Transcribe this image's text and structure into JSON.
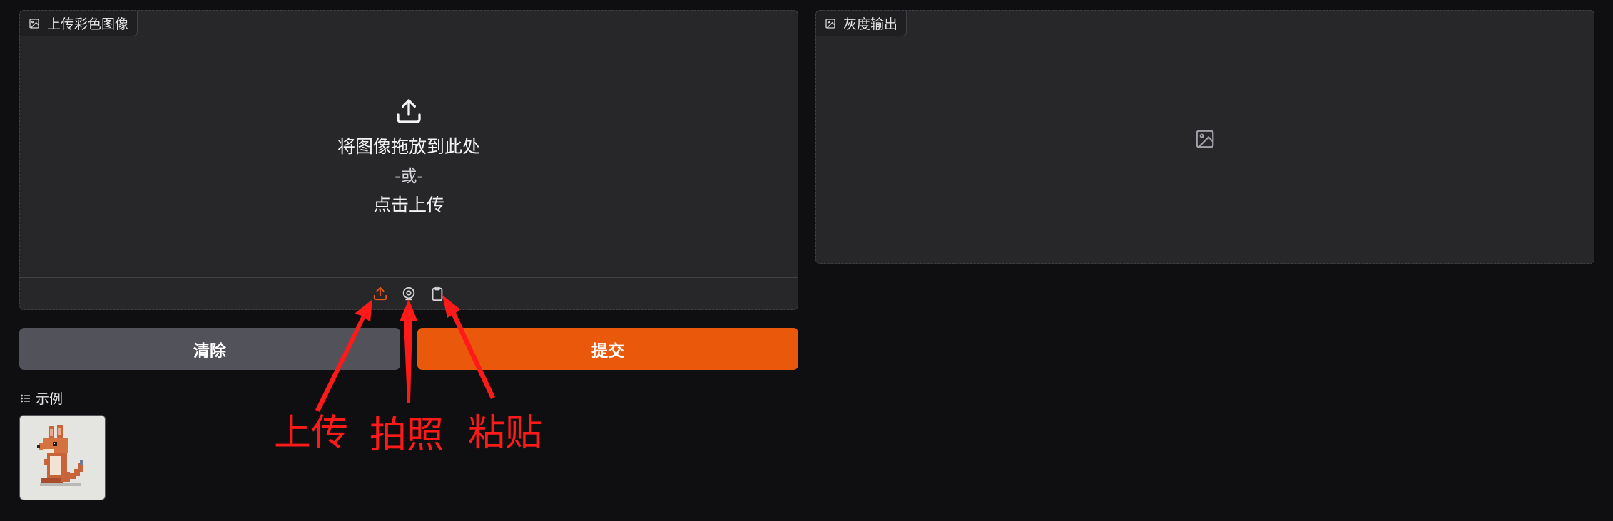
{
  "input_panel": {
    "label": "上传彩色图像",
    "drop_title": "将图像拖放到此处",
    "drop_or": "-或-",
    "drop_click": "点击上传",
    "sources": [
      "upload-icon",
      "webcam-icon",
      "clipboard-icon"
    ],
    "active_source_color": "#ea580c"
  },
  "output_panel": {
    "label": "灰度输出"
  },
  "buttons": {
    "clear": "清除",
    "submit": "提交",
    "submit_color": "#ea580c"
  },
  "examples": {
    "label": "示例"
  },
  "annotations": {
    "upload": "上传",
    "webcam": "拍照",
    "paste": "粘贴",
    "color": "#ff1a1a"
  }
}
